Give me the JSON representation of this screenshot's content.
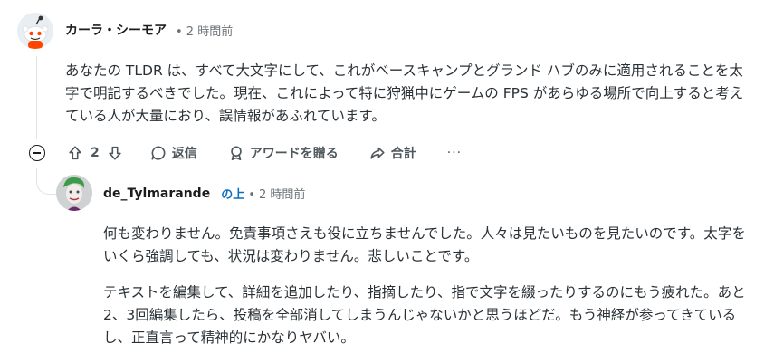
{
  "comment1": {
    "author": "カーラ・シーモア",
    "time": "• 2 時間前",
    "body": "あなたの TLDR は、すべて大文字にして、これがベースキャンプとグランド ハブのみに適用されることを太字で明記するべきでした。現在、これによって特に狩猟中にゲームの FPS があらゆる場所で向上すると考えている人が大量におり、誤情報があふれています。",
    "actions": {
      "votes": "2",
      "reply": "返信",
      "award": "アワードを贈る",
      "share": "合計",
      "more": "···"
    }
  },
  "comment2": {
    "author": "de_Tylmarande",
    "flair": "の上",
    "time": "• 2 時間前",
    "paragraphs": [
      "何も変わりません。免責事項さえも役に立ちませんでした。人々は見たいものを見たいのです。太字をいくら強調しても、状況は変わりません。悲しいことです。",
      "テキストを編集して、詳細を追加したり、指摘したり、指で文字を綴ったりするのにもう疲れた。あと2、3回編集したら、投稿を全部消してしまうんじゃないかと思うほどだ。もう神経が参ってきているし、正直言って精神的にかなりヤバい。"
    ]
  }
}
